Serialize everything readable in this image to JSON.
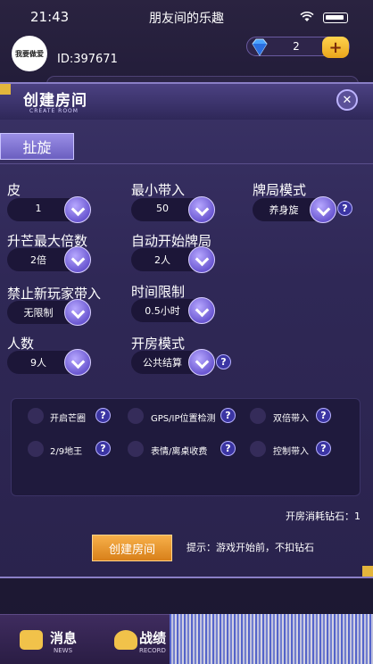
{
  "status_bar": {
    "time": "21:43",
    "title": "朋友间的乐趣"
  },
  "profile": {
    "avatar_text": "我要做爱",
    "user_id": "ID:397671"
  },
  "diamonds": {
    "count": "2",
    "plus_label": "+"
  },
  "dialog": {
    "title": "创建房间",
    "subtitle": "CREATE ROOM",
    "close_label": "✕",
    "game_tab": "扯旋",
    "settings": {
      "pi": {
        "label": "皮",
        "value": "1"
      },
      "min_bring": {
        "label": "最小带入",
        "value": "50"
      },
      "game_mode": {
        "label": "牌局模式",
        "value": "养身旋"
      },
      "max_mult": {
        "label": "升芒最大倍数",
        "value": "2倍"
      },
      "auto_start": {
        "label": "自动开始牌局",
        "value": "2人"
      },
      "ban_new": {
        "label": "禁止新玩家带入",
        "value": "无限制"
      },
      "time_limit": {
        "label": "时间限制",
        "value": "0.5小时"
      },
      "players": {
        "label": "人数",
        "value": "9人"
      },
      "room_mode": {
        "label": "开房模式",
        "value": "公共结算"
      }
    },
    "options": [
      {
        "label": "开启芒圈"
      },
      {
        "label": "GPS/IP位置检测"
      },
      {
        "label": "双倍带入"
      },
      {
        "label": "2/9地王"
      },
      {
        "label": "表情/离桌收费"
      },
      {
        "label": "控制带入"
      }
    ],
    "cost_text": "开房消耗钻石：1",
    "create_button": "创建房间",
    "tip_text": "提示：游戏开始前，不扣钻石",
    "help_glyph": "?"
  },
  "bottom_nav": [
    {
      "label": "消息",
      "sub": "NEWS"
    },
    {
      "label": "战绩",
      "sub": "RECORD"
    }
  ],
  "colors": {
    "accent": "#6a57d1",
    "gold": "#e3b53c",
    "button": "#f7b04a"
  }
}
